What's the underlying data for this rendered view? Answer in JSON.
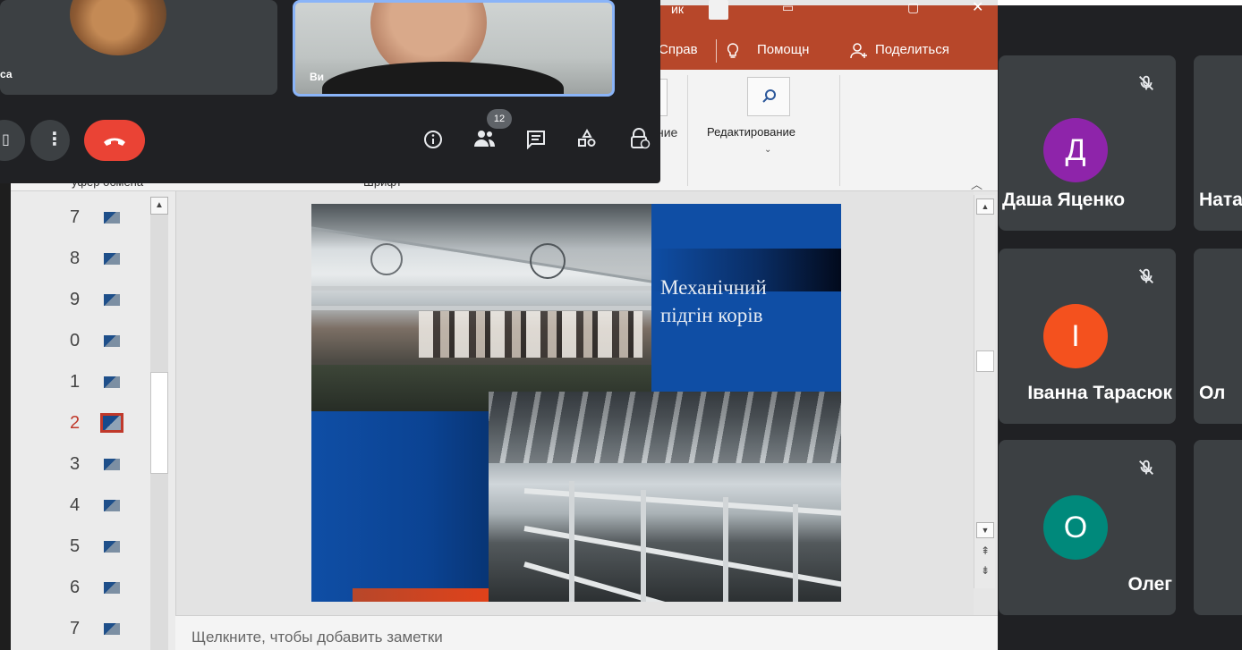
{
  "powerpoint": {
    "tabs": {
      "review_partial": "Справ",
      "help": "Помощн",
      "share": "Поделиться",
      "ribbon_left_partial": "ние",
      "editing_label": "Редактирование",
      "clipboard_partial": "уфер обмена",
      "font_partial": "Шрифт"
    },
    "title_partial": "ик",
    "thumbnails": [
      {
        "number": "7",
        "active": false
      },
      {
        "number": "8",
        "active": false
      },
      {
        "number": "9",
        "active": false
      },
      {
        "number": "0",
        "active": false
      },
      {
        "number": "1",
        "active": false
      },
      {
        "number": "2",
        "active": true
      },
      {
        "number": "3",
        "active": false
      },
      {
        "number": "4",
        "active": false
      },
      {
        "number": "5",
        "active": false
      },
      {
        "number": "6",
        "active": false
      },
      {
        "number": "7",
        "active": false
      }
    ],
    "slide": {
      "title_line1": "Механічний",
      "title_line2": "підгін корів"
    },
    "notes_placeholder": "Щелкните, чтобы добавить заметки"
  },
  "meet": {
    "participants": [
      {
        "name": "Даша Яценко",
        "initial": "Д",
        "avatar_color": "#8e24aa",
        "muted": true
      },
      {
        "name": "Натал",
        "initial": "",
        "avatar_color": "",
        "muted": false
      },
      {
        "name": "Іванна Тарасюк",
        "initial": "І",
        "avatar_color": "#f4511e",
        "muted": true
      },
      {
        "name": "Ол",
        "initial": "",
        "avatar_color": "",
        "muted": false
      },
      {
        "name": "Олег",
        "initial": "О",
        "avatar_color": "#00897b",
        "muted": true
      }
    ],
    "top_tiles": {
      "left_name_partial": "са",
      "self_name": "Ви"
    },
    "people_count": "12",
    "colors": {
      "end_call": "#ea4335",
      "self_outline": "#8ab4f8",
      "ppt_accent": "#b7472a"
    }
  }
}
